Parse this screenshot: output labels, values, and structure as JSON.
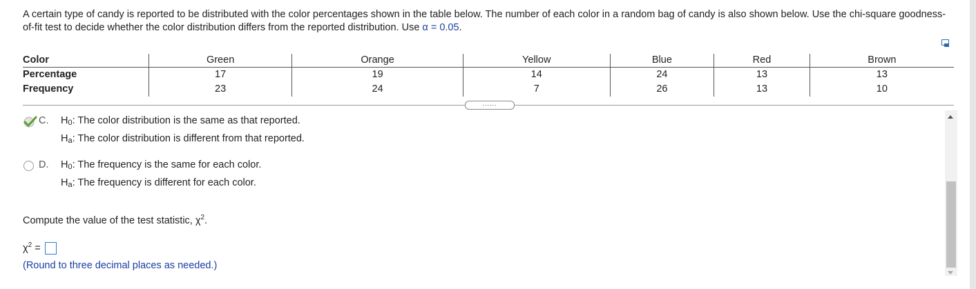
{
  "problem": {
    "text_before_alpha": "A certain type of candy is reported to be distributed with the color percentages shown in the table below. The number of each color in a random bag of candy is also shown below. Use the chi-square goodness-of-fit test to decide whether the color distribution differs from the reported distribution. Use",
    "alpha_expr": "α = 0.05",
    "text_end": "."
  },
  "table": {
    "row_headers": [
      "Color",
      "Percentage",
      "Frequency"
    ],
    "colors": [
      "Green",
      "Orange",
      "Yellow",
      "Blue",
      "Red",
      "Brown"
    ],
    "percentages": [
      "17",
      "19",
      "14",
      "24",
      "13",
      "13"
    ],
    "frequencies": [
      "23",
      "24",
      "7",
      "26",
      "13",
      "10"
    ]
  },
  "expand_dots": "......",
  "options": [
    {
      "letter": "C.",
      "h0_label": "H",
      "h0_sub": "0",
      "h0_text": ": The color distribution is the same as that reported.",
      "ha_label": "H",
      "ha_sub": "a",
      "ha_text": ": The color distribution is different from that reported.",
      "selected": true
    },
    {
      "letter": "D.",
      "h0_label": "H",
      "h0_sub": "0",
      "h0_text": ": The frequency is the same for each color.",
      "ha_label": "H",
      "ha_sub": "a",
      "ha_text": ": The frequency is different for each color.",
      "selected": false
    }
  ],
  "compute": {
    "text": "Compute the value of the test statistic,",
    "symbol": "χ",
    "exp": "2",
    "end": "."
  },
  "answer": {
    "symbol": "χ",
    "exp": "2",
    "equals": " =",
    "value": ""
  },
  "note": "(Round to three decimal places as needed.)",
  "colors": {
    "check_green": "#5aa02c",
    "link_blue": "#1a3fa0",
    "input_border": "#2a7fd0"
  }
}
